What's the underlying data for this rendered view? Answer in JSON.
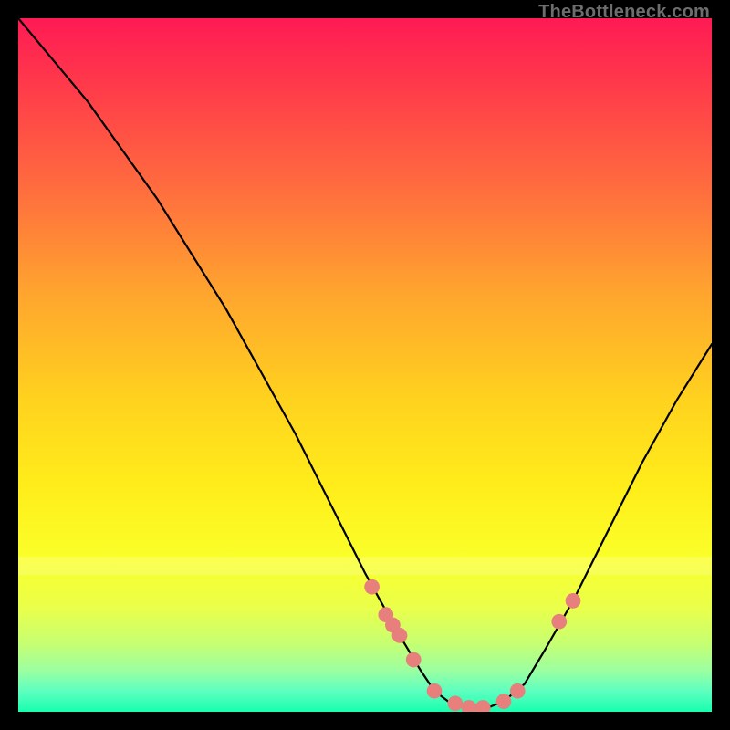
{
  "attribution": "TheBottleneck.com",
  "chart_data": {
    "type": "line",
    "title": "",
    "xlabel": "",
    "ylabel": "",
    "xlim": [
      0,
      100
    ],
    "ylim": [
      0,
      100
    ],
    "series": [
      {
        "name": "curve",
        "x": [
          0,
          5,
          10,
          15,
          20,
          25,
          30,
          35,
          40,
          45,
          50,
          55,
          58,
          60,
          62,
          64,
          66,
          68,
          70,
          73,
          76,
          80,
          85,
          90,
          95,
          100
        ],
        "values": [
          100,
          94,
          88,
          81,
          74,
          66,
          58,
          49,
          40,
          30,
          20,
          11,
          6,
          3,
          1.5,
          0.8,
          0.5,
          0.7,
          1.5,
          4,
          9,
          16,
          26,
          36,
          45,
          53
        ]
      }
    ],
    "markers": {
      "color": "#e77f7d",
      "radius_pct": 1.1,
      "points_idx_on_curve_x": [
        51,
        53,
        54,
        55,
        57,
        60,
        63,
        65,
        67,
        70,
        72,
        78,
        80
      ],
      "points": [
        {
          "x": 51,
          "y": 18
        },
        {
          "x": 53,
          "y": 14
        },
        {
          "x": 54,
          "y": 12.5
        },
        {
          "x": 55,
          "y": 11
        },
        {
          "x": 57,
          "y": 7.5
        },
        {
          "x": 60,
          "y": 3
        },
        {
          "x": 63,
          "y": 1.2
        },
        {
          "x": 65,
          "y": 0.6
        },
        {
          "x": 67,
          "y": 0.6
        },
        {
          "x": 70,
          "y": 1.5
        },
        {
          "x": 72,
          "y": 3
        },
        {
          "x": 78,
          "y": 13
        },
        {
          "x": 80,
          "y": 16
        }
      ]
    },
    "background_gradient_stops": [
      {
        "pct": 0,
        "color": "#ff1a54"
      },
      {
        "pct": 25,
        "color": "#ff6e3e"
      },
      {
        "pct": 55,
        "color": "#ffd21e"
      },
      {
        "pct": 78,
        "color": "#faff2a"
      },
      {
        "pct": 94,
        "color": "#9cffa0"
      },
      {
        "pct": 100,
        "color": "#18ffaf"
      }
    ]
  }
}
